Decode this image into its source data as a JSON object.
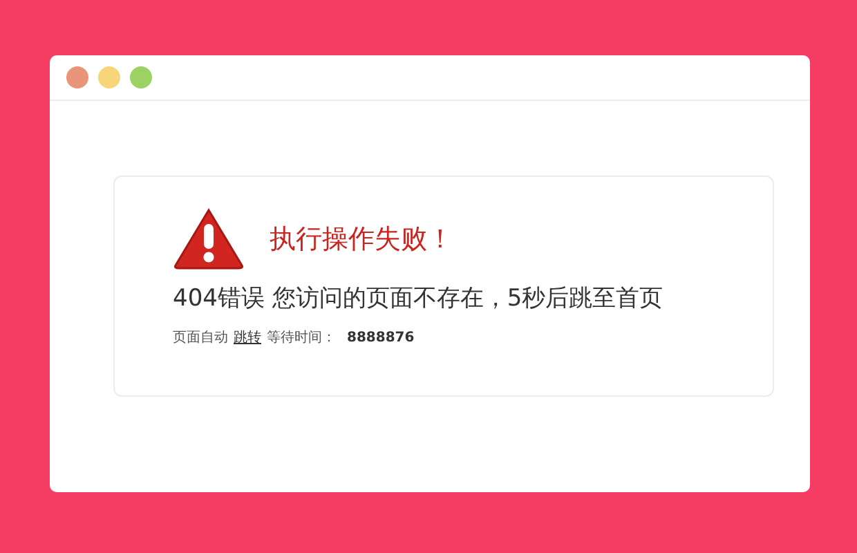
{
  "window": {
    "buttons": [
      {
        "color": "#e8957a"
      },
      {
        "color": "#f7d57a"
      },
      {
        "color": "#9bd262"
      }
    ]
  },
  "alert": {
    "title": "执行操作失败！",
    "message": "404错误 您访问的页面不存在，5秒后跳至首页",
    "redirect": {
      "before": "页面自动",
      "link": "跳转",
      "after": "等待时间：",
      "count": "8888876"
    }
  }
}
